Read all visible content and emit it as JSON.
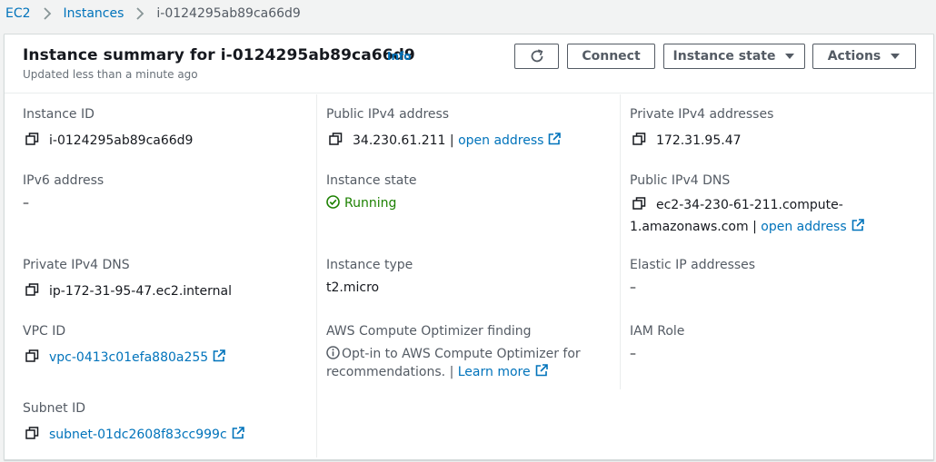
{
  "breadcrumb": {
    "ec2": "EC2",
    "instances": "Instances",
    "current": "i-0124295ab89ca66d9"
  },
  "header": {
    "title": "Instance summary for i-0124295ab89ca66d9",
    "info": "Info",
    "subtitle": "Updated less than a minute ago",
    "connect_label": "Connect",
    "instance_state_label": "Instance state",
    "actions_label": "Actions"
  },
  "fields": {
    "instance_id": {
      "label": "Instance ID",
      "value": "i-0124295ab89ca66d9"
    },
    "public_ipv4": {
      "label": "Public IPv4 address",
      "value": "34.230.61.211",
      "sep": "|",
      "link": "open address"
    },
    "private_ipv4": {
      "label": "Private IPv4 addresses",
      "value": "172.31.95.47"
    },
    "ipv6": {
      "label": "IPv6 address",
      "value": "–"
    },
    "instance_state": {
      "label": "Instance state",
      "value": "Running"
    },
    "public_dns": {
      "label": "Public IPv4 DNS",
      "value_line1": "ec2-34-230-61-211.compute-",
      "value_line2": "1.amazonaws.com",
      "sep": "|",
      "link": "open address"
    },
    "private_dns": {
      "label": "Private IPv4 DNS",
      "value": "ip-172-31-95-47.ec2.internal"
    },
    "instance_type": {
      "label": "Instance type",
      "value": "t2.micro"
    },
    "elastic_ip": {
      "label": "Elastic IP addresses",
      "value": "–"
    },
    "vpc_id": {
      "label": "VPC ID",
      "value": "vpc-0413c01efa880a255"
    },
    "optimizer": {
      "label": "AWS Compute Optimizer finding",
      "text_line1": "Opt-in to AWS Compute Optimizer for",
      "text_line2": "recommendations.",
      "sep": "|",
      "link": "Learn more"
    },
    "iam_role": {
      "label": "IAM Role",
      "value": "–"
    },
    "subnet_id": {
      "label": "Subnet ID",
      "value": "subnet-01dc2608f83cc999c"
    }
  },
  "colors": {
    "link": "#0073bb",
    "running": "#1d8102",
    "label": "#545b64"
  }
}
